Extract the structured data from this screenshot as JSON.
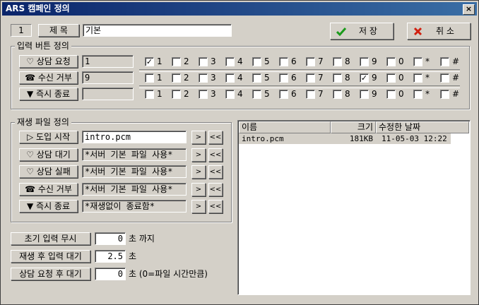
{
  "window": {
    "title": "ARS 캠페인 정의",
    "close": "×"
  },
  "top": {
    "id": "1",
    "title_label": "제 목",
    "title_value": "기본",
    "save": "저 장",
    "cancel": "취 소"
  },
  "input_group": {
    "label": "입력 버튼 정의",
    "options": [
      "1",
      "2",
      "3",
      "4",
      "5",
      "6",
      "7",
      "8",
      "9",
      "0",
      "*",
      "#"
    ],
    "rows": [
      {
        "icon": "♡",
        "label": "상담 요청",
        "value": "1",
        "checked": [
          "1"
        ]
      },
      {
        "icon": "☎",
        "label": "수신 거부",
        "value": "9",
        "checked": [
          "9"
        ]
      },
      {
        "icon": "▼",
        "label": "즉시 종료",
        "value": "",
        "checked": []
      }
    ]
  },
  "play_group": {
    "label": "재생 파일 정의",
    "btn_select": ">",
    "btn_clear": "<<",
    "rows": [
      {
        "icon": "▷",
        "label": "도입 시작",
        "value": "intro.pcm",
        "active": true
      },
      {
        "icon": "♡",
        "label": "상담 대기",
        "value": "*서버 기본 파일 사용*",
        "active": false
      },
      {
        "icon": "♡",
        "label": "상담 실패",
        "value": "*서버 기본 파일 사용*",
        "active": false
      },
      {
        "icon": "☎",
        "label": "수신 거부",
        "value": "*서버 기본 파일 사용*",
        "active": false
      },
      {
        "icon": "▼",
        "label": "즉시 종료",
        "value": "*재생없이 종료함*",
        "active": false
      }
    ]
  },
  "timers": [
    {
      "label": "초기 입력 무시",
      "value": "0",
      "suffix": "초 까지"
    },
    {
      "label": "재생 후 입력 대기",
      "value": "2.5",
      "suffix": "초"
    },
    {
      "label": "상담 요청 후 대기",
      "value": "0",
      "suffix": "초 (0=파일 시간만큼)"
    }
  ],
  "file_list": {
    "headers": [
      "이름",
      "크기",
      "수정한 날짜"
    ],
    "rows": [
      {
        "name": "intro.pcm",
        "size": "181KB",
        "date": "11-05-03 12:22"
      }
    ]
  }
}
